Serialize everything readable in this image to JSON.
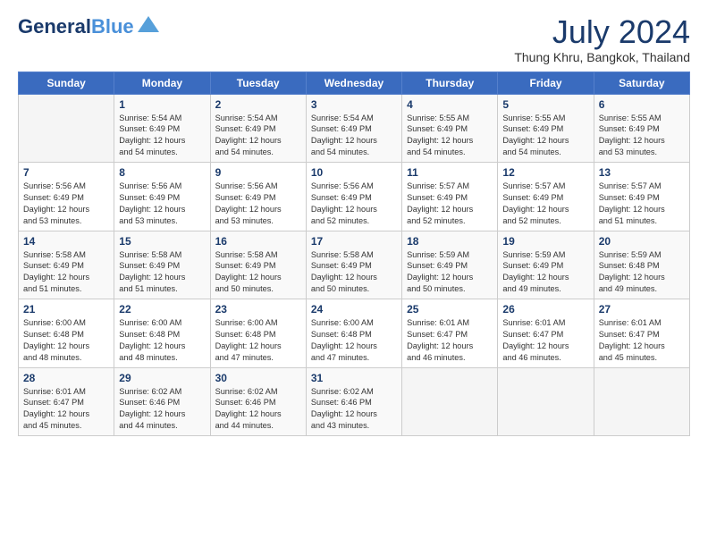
{
  "header": {
    "logo_line1": "General",
    "logo_line2": "Blue",
    "month_year": "July 2024",
    "location": "Thung Khru, Bangkok, Thailand"
  },
  "days_of_week": [
    "Sunday",
    "Monday",
    "Tuesday",
    "Wednesday",
    "Thursday",
    "Friday",
    "Saturday"
  ],
  "weeks": [
    [
      {
        "day": "",
        "sunrise": "",
        "sunset": "",
        "daylight": ""
      },
      {
        "day": "1",
        "sunrise": "Sunrise: 5:54 AM",
        "sunset": "Sunset: 6:49 PM",
        "daylight": "Daylight: 12 hours and 54 minutes."
      },
      {
        "day": "2",
        "sunrise": "Sunrise: 5:54 AM",
        "sunset": "Sunset: 6:49 PM",
        "daylight": "Daylight: 12 hours and 54 minutes."
      },
      {
        "day": "3",
        "sunrise": "Sunrise: 5:54 AM",
        "sunset": "Sunset: 6:49 PM",
        "daylight": "Daylight: 12 hours and 54 minutes."
      },
      {
        "day": "4",
        "sunrise": "Sunrise: 5:55 AM",
        "sunset": "Sunset: 6:49 PM",
        "daylight": "Daylight: 12 hours and 54 minutes."
      },
      {
        "day": "5",
        "sunrise": "Sunrise: 5:55 AM",
        "sunset": "Sunset: 6:49 PM",
        "daylight": "Daylight: 12 hours and 54 minutes."
      },
      {
        "day": "6",
        "sunrise": "Sunrise: 5:55 AM",
        "sunset": "Sunset: 6:49 PM",
        "daylight": "Daylight: 12 hours and 53 minutes."
      }
    ],
    [
      {
        "day": "7",
        "sunrise": "Sunrise: 5:56 AM",
        "sunset": "Sunset: 6:49 PM",
        "daylight": "Daylight: 12 hours and 53 minutes."
      },
      {
        "day": "8",
        "sunrise": "Sunrise: 5:56 AM",
        "sunset": "Sunset: 6:49 PM",
        "daylight": "Daylight: 12 hours and 53 minutes."
      },
      {
        "day": "9",
        "sunrise": "Sunrise: 5:56 AM",
        "sunset": "Sunset: 6:49 PM",
        "daylight": "Daylight: 12 hours and 53 minutes."
      },
      {
        "day": "10",
        "sunrise": "Sunrise: 5:56 AM",
        "sunset": "Sunset: 6:49 PM",
        "daylight": "Daylight: 12 hours and 52 minutes."
      },
      {
        "day": "11",
        "sunrise": "Sunrise: 5:57 AM",
        "sunset": "Sunset: 6:49 PM",
        "daylight": "Daylight: 12 hours and 52 minutes."
      },
      {
        "day": "12",
        "sunrise": "Sunrise: 5:57 AM",
        "sunset": "Sunset: 6:49 PM",
        "daylight": "Daylight: 12 hours and 52 minutes."
      },
      {
        "day": "13",
        "sunrise": "Sunrise: 5:57 AM",
        "sunset": "Sunset: 6:49 PM",
        "daylight": "Daylight: 12 hours and 51 minutes."
      }
    ],
    [
      {
        "day": "14",
        "sunrise": "Sunrise: 5:58 AM",
        "sunset": "Sunset: 6:49 PM",
        "daylight": "Daylight: 12 hours and 51 minutes."
      },
      {
        "day": "15",
        "sunrise": "Sunrise: 5:58 AM",
        "sunset": "Sunset: 6:49 PM",
        "daylight": "Daylight: 12 hours and 51 minutes."
      },
      {
        "day": "16",
        "sunrise": "Sunrise: 5:58 AM",
        "sunset": "Sunset: 6:49 PM",
        "daylight": "Daylight: 12 hours and 50 minutes."
      },
      {
        "day": "17",
        "sunrise": "Sunrise: 5:58 AM",
        "sunset": "Sunset: 6:49 PM",
        "daylight": "Daylight: 12 hours and 50 minutes."
      },
      {
        "day": "18",
        "sunrise": "Sunrise: 5:59 AM",
        "sunset": "Sunset: 6:49 PM",
        "daylight": "Daylight: 12 hours and 50 minutes."
      },
      {
        "day": "19",
        "sunrise": "Sunrise: 5:59 AM",
        "sunset": "Sunset: 6:49 PM",
        "daylight": "Daylight: 12 hours and 49 minutes."
      },
      {
        "day": "20",
        "sunrise": "Sunrise: 5:59 AM",
        "sunset": "Sunset: 6:48 PM",
        "daylight": "Daylight: 12 hours and 49 minutes."
      }
    ],
    [
      {
        "day": "21",
        "sunrise": "Sunrise: 6:00 AM",
        "sunset": "Sunset: 6:48 PM",
        "daylight": "Daylight: 12 hours and 48 minutes."
      },
      {
        "day": "22",
        "sunrise": "Sunrise: 6:00 AM",
        "sunset": "Sunset: 6:48 PM",
        "daylight": "Daylight: 12 hours and 48 minutes."
      },
      {
        "day": "23",
        "sunrise": "Sunrise: 6:00 AM",
        "sunset": "Sunset: 6:48 PM",
        "daylight": "Daylight: 12 hours and 47 minutes."
      },
      {
        "day": "24",
        "sunrise": "Sunrise: 6:00 AM",
        "sunset": "Sunset: 6:48 PM",
        "daylight": "Daylight: 12 hours and 47 minutes."
      },
      {
        "day": "25",
        "sunrise": "Sunrise: 6:01 AM",
        "sunset": "Sunset: 6:47 PM",
        "daylight": "Daylight: 12 hours and 46 minutes."
      },
      {
        "day": "26",
        "sunrise": "Sunrise: 6:01 AM",
        "sunset": "Sunset: 6:47 PM",
        "daylight": "Daylight: 12 hours and 46 minutes."
      },
      {
        "day": "27",
        "sunrise": "Sunrise: 6:01 AM",
        "sunset": "Sunset: 6:47 PM",
        "daylight": "Daylight: 12 hours and 45 minutes."
      }
    ],
    [
      {
        "day": "28",
        "sunrise": "Sunrise: 6:01 AM",
        "sunset": "Sunset: 6:47 PM",
        "daylight": "Daylight: 12 hours and 45 minutes."
      },
      {
        "day": "29",
        "sunrise": "Sunrise: 6:02 AM",
        "sunset": "Sunset: 6:46 PM",
        "daylight": "Daylight: 12 hours and 44 minutes."
      },
      {
        "day": "30",
        "sunrise": "Sunrise: 6:02 AM",
        "sunset": "Sunset: 6:46 PM",
        "daylight": "Daylight: 12 hours and 44 minutes."
      },
      {
        "day": "31",
        "sunrise": "Sunrise: 6:02 AM",
        "sunset": "Sunset: 6:46 PM",
        "daylight": "Daylight: 12 hours and 43 minutes."
      },
      {
        "day": "",
        "sunrise": "",
        "sunset": "",
        "daylight": ""
      },
      {
        "day": "",
        "sunrise": "",
        "sunset": "",
        "daylight": ""
      },
      {
        "day": "",
        "sunrise": "",
        "sunset": "",
        "daylight": ""
      }
    ]
  ]
}
